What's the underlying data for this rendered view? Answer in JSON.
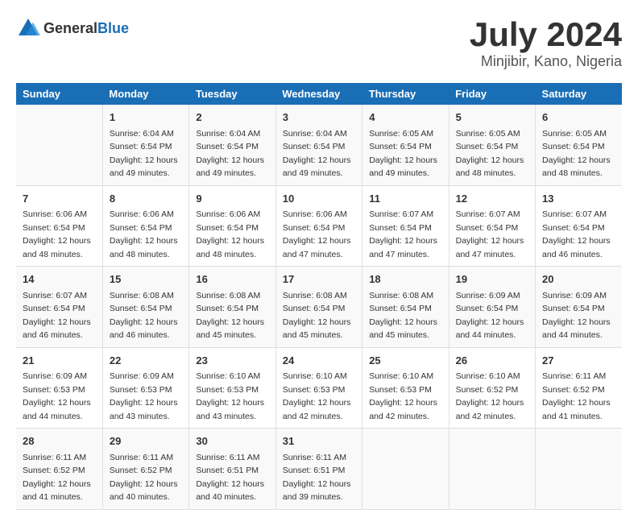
{
  "header": {
    "logo_general": "General",
    "logo_blue": "Blue",
    "title": "July 2024",
    "subtitle": "Minjibir, Kano, Nigeria"
  },
  "days_of_week": [
    "Sunday",
    "Monday",
    "Tuesday",
    "Wednesday",
    "Thursday",
    "Friday",
    "Saturday"
  ],
  "weeks": [
    [
      {
        "day": "",
        "sunrise": "",
        "sunset": "",
        "daylight": ""
      },
      {
        "day": "1",
        "sunrise": "Sunrise: 6:04 AM",
        "sunset": "Sunset: 6:54 PM",
        "daylight": "Daylight: 12 hours and 49 minutes."
      },
      {
        "day": "2",
        "sunrise": "Sunrise: 6:04 AM",
        "sunset": "Sunset: 6:54 PM",
        "daylight": "Daylight: 12 hours and 49 minutes."
      },
      {
        "day": "3",
        "sunrise": "Sunrise: 6:04 AM",
        "sunset": "Sunset: 6:54 PM",
        "daylight": "Daylight: 12 hours and 49 minutes."
      },
      {
        "day": "4",
        "sunrise": "Sunrise: 6:05 AM",
        "sunset": "Sunset: 6:54 PM",
        "daylight": "Daylight: 12 hours and 49 minutes."
      },
      {
        "day": "5",
        "sunrise": "Sunrise: 6:05 AM",
        "sunset": "Sunset: 6:54 PM",
        "daylight": "Daylight: 12 hours and 48 minutes."
      },
      {
        "day": "6",
        "sunrise": "Sunrise: 6:05 AM",
        "sunset": "Sunset: 6:54 PM",
        "daylight": "Daylight: 12 hours and 48 minutes."
      }
    ],
    [
      {
        "day": "7",
        "sunrise": "Sunrise: 6:06 AM",
        "sunset": "Sunset: 6:54 PM",
        "daylight": "Daylight: 12 hours and 48 minutes."
      },
      {
        "day": "8",
        "sunrise": "Sunrise: 6:06 AM",
        "sunset": "Sunset: 6:54 PM",
        "daylight": "Daylight: 12 hours and 48 minutes."
      },
      {
        "day": "9",
        "sunrise": "Sunrise: 6:06 AM",
        "sunset": "Sunset: 6:54 PM",
        "daylight": "Daylight: 12 hours and 48 minutes."
      },
      {
        "day": "10",
        "sunrise": "Sunrise: 6:06 AM",
        "sunset": "Sunset: 6:54 PM",
        "daylight": "Daylight: 12 hours and 47 minutes."
      },
      {
        "day": "11",
        "sunrise": "Sunrise: 6:07 AM",
        "sunset": "Sunset: 6:54 PM",
        "daylight": "Daylight: 12 hours and 47 minutes."
      },
      {
        "day": "12",
        "sunrise": "Sunrise: 6:07 AM",
        "sunset": "Sunset: 6:54 PM",
        "daylight": "Daylight: 12 hours and 47 minutes."
      },
      {
        "day": "13",
        "sunrise": "Sunrise: 6:07 AM",
        "sunset": "Sunset: 6:54 PM",
        "daylight": "Daylight: 12 hours and 46 minutes."
      }
    ],
    [
      {
        "day": "14",
        "sunrise": "Sunrise: 6:07 AM",
        "sunset": "Sunset: 6:54 PM",
        "daylight": "Daylight: 12 hours and 46 minutes."
      },
      {
        "day": "15",
        "sunrise": "Sunrise: 6:08 AM",
        "sunset": "Sunset: 6:54 PM",
        "daylight": "Daylight: 12 hours and 46 minutes."
      },
      {
        "day": "16",
        "sunrise": "Sunrise: 6:08 AM",
        "sunset": "Sunset: 6:54 PM",
        "daylight": "Daylight: 12 hours and 45 minutes."
      },
      {
        "day": "17",
        "sunrise": "Sunrise: 6:08 AM",
        "sunset": "Sunset: 6:54 PM",
        "daylight": "Daylight: 12 hours and 45 minutes."
      },
      {
        "day": "18",
        "sunrise": "Sunrise: 6:08 AM",
        "sunset": "Sunset: 6:54 PM",
        "daylight": "Daylight: 12 hours and 45 minutes."
      },
      {
        "day": "19",
        "sunrise": "Sunrise: 6:09 AM",
        "sunset": "Sunset: 6:54 PM",
        "daylight": "Daylight: 12 hours and 44 minutes."
      },
      {
        "day": "20",
        "sunrise": "Sunrise: 6:09 AM",
        "sunset": "Sunset: 6:54 PM",
        "daylight": "Daylight: 12 hours and 44 minutes."
      }
    ],
    [
      {
        "day": "21",
        "sunrise": "Sunrise: 6:09 AM",
        "sunset": "Sunset: 6:53 PM",
        "daylight": "Daylight: 12 hours and 44 minutes."
      },
      {
        "day": "22",
        "sunrise": "Sunrise: 6:09 AM",
        "sunset": "Sunset: 6:53 PM",
        "daylight": "Daylight: 12 hours and 43 minutes."
      },
      {
        "day": "23",
        "sunrise": "Sunrise: 6:10 AM",
        "sunset": "Sunset: 6:53 PM",
        "daylight": "Daylight: 12 hours and 43 minutes."
      },
      {
        "day": "24",
        "sunrise": "Sunrise: 6:10 AM",
        "sunset": "Sunset: 6:53 PM",
        "daylight": "Daylight: 12 hours and 42 minutes."
      },
      {
        "day": "25",
        "sunrise": "Sunrise: 6:10 AM",
        "sunset": "Sunset: 6:53 PM",
        "daylight": "Daylight: 12 hours and 42 minutes."
      },
      {
        "day": "26",
        "sunrise": "Sunrise: 6:10 AM",
        "sunset": "Sunset: 6:52 PM",
        "daylight": "Daylight: 12 hours and 42 minutes."
      },
      {
        "day": "27",
        "sunrise": "Sunrise: 6:11 AM",
        "sunset": "Sunset: 6:52 PM",
        "daylight": "Daylight: 12 hours and 41 minutes."
      }
    ],
    [
      {
        "day": "28",
        "sunrise": "Sunrise: 6:11 AM",
        "sunset": "Sunset: 6:52 PM",
        "daylight": "Daylight: 12 hours and 41 minutes."
      },
      {
        "day": "29",
        "sunrise": "Sunrise: 6:11 AM",
        "sunset": "Sunset: 6:52 PM",
        "daylight": "Daylight: 12 hours and 40 minutes."
      },
      {
        "day": "30",
        "sunrise": "Sunrise: 6:11 AM",
        "sunset": "Sunset: 6:51 PM",
        "daylight": "Daylight: 12 hours and 40 minutes."
      },
      {
        "day": "31",
        "sunrise": "Sunrise: 6:11 AM",
        "sunset": "Sunset: 6:51 PM",
        "daylight": "Daylight: 12 hours and 39 minutes."
      },
      {
        "day": "",
        "sunrise": "",
        "sunset": "",
        "daylight": ""
      },
      {
        "day": "",
        "sunrise": "",
        "sunset": "",
        "daylight": ""
      },
      {
        "day": "",
        "sunrise": "",
        "sunset": "",
        "daylight": ""
      }
    ]
  ]
}
